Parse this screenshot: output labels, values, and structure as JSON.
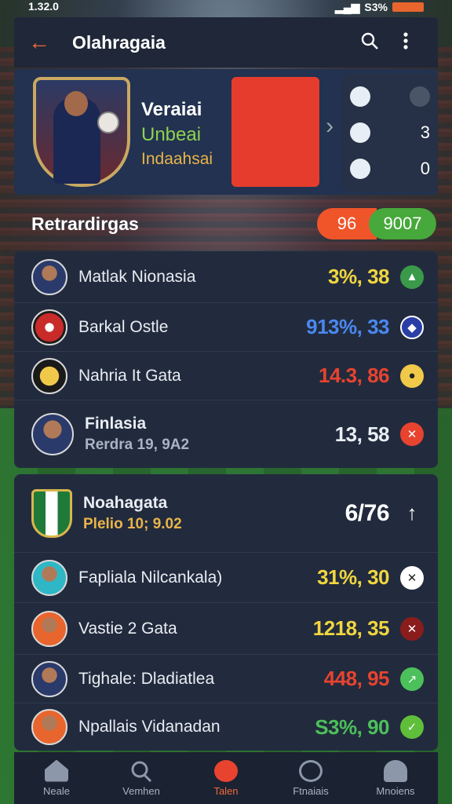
{
  "status": {
    "time": "1.32.0",
    "battery": "S3%"
  },
  "appbar": {
    "title": "Olahragaia"
  },
  "hero": {
    "line1": "Veraiai",
    "line2": "Unbeai",
    "line3": "Indaahsai",
    "side_values": [
      "",
      "3",
      "0"
    ]
  },
  "ratings": {
    "heading": "Retrardirgas",
    "pill_left": "96",
    "pill_right": "9007"
  },
  "list1": [
    {
      "name": "Matlak Nionasia",
      "value": "3%, 38",
      "color": "#f0d640"
    },
    {
      "name": "Barkal Ostle",
      "value": "913%, 33",
      "color": "#4a88f0"
    },
    {
      "name": "Nahria It Gata",
      "value": "14.3, 86",
      "color": "#e8432f"
    },
    {
      "name": "Finlasia",
      "sub": "Rerdra 19, 9A2",
      "value": "13, 58",
      "color": "#e9eef4"
    }
  ],
  "list2": [
    {
      "name": "Noahagata",
      "sub": "Plelio 10; 9.02",
      "value": "6/76",
      "color": "#ffffff"
    },
    {
      "name": "Fapliala Nilcankala)",
      "value": "31%, 30",
      "color": "#f0d640"
    },
    {
      "name": "Vastie 2 Gata",
      "value": "1218, 35",
      "color": "#f0d640"
    },
    {
      "name": "Tighale: Dladiatlea",
      "value": "448, 95",
      "color": "#e8432f"
    },
    {
      "name": "Npallais Vidanadan",
      "value": "S3%, 90",
      "color": "#4cc05a"
    }
  ],
  "tabs": [
    "Neale",
    "Vemhen",
    "Talen",
    "Ftnaiais",
    "Mnoiens"
  ]
}
